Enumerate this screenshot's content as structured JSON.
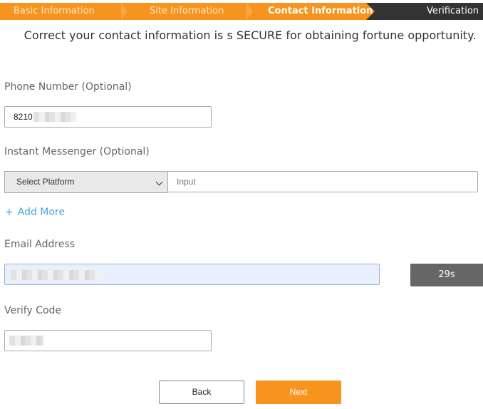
{
  "colors": {
    "accent": "#f7941d",
    "stepper_dark": "#333333",
    "link": "#4aa3df",
    "timer_bg": "#666666"
  },
  "steps": [
    {
      "label": "Basic Information",
      "state": "done"
    },
    {
      "label": "Site Information",
      "state": "done"
    },
    {
      "label": "Contact Information",
      "state": "active"
    },
    {
      "label": "Verification",
      "state": "upcoming"
    }
  ],
  "headline": "Correct your contact information is s SECURE for obtaining fortune opportunity.",
  "phone": {
    "label": "Phone Number (Optional)",
    "value": "8210"
  },
  "messenger": {
    "label": "Instant Messenger (Optional)",
    "platform_selected": "Select Platform",
    "input_placeholder": "Input",
    "chevron_icon": "chevron-down-icon"
  },
  "add_more": {
    "icon": "+",
    "label": "Add More"
  },
  "email": {
    "label": "Email Address",
    "timer": "29s"
  },
  "verify": {
    "label": "Verify Code"
  },
  "buttons": {
    "back": "Back",
    "next": "Next"
  }
}
